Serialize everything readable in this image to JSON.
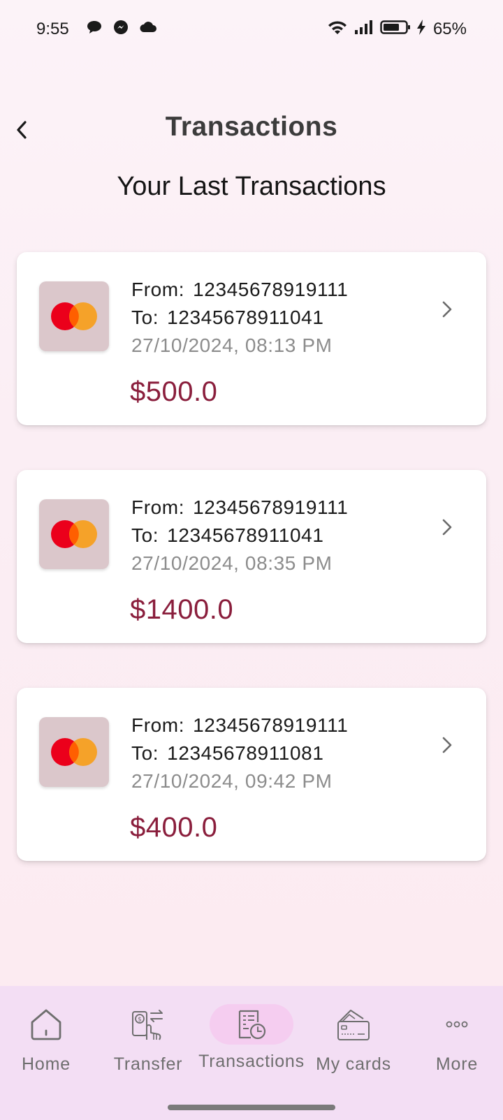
{
  "status_bar": {
    "time": "9:55",
    "battery": "65%",
    "notification_icons": [
      "chat-bubble-icon",
      "messenger-icon",
      "cloud-icon"
    ],
    "system_icons": [
      "wifi-icon",
      "signal-icon",
      "battery-icon",
      "charging-icon"
    ]
  },
  "header": {
    "title": "Transactions",
    "back_icon": "chevron-left-icon"
  },
  "subtitle": "Your Last Transactions",
  "transactions": [
    {
      "from_label": "From:",
      "from": "12345678919111",
      "to_label": "To:",
      "to": "12345678911041",
      "date": "27/10/2024, 08:13 PM",
      "amount": "$500.0"
    },
    {
      "from_label": "From:",
      "from": "12345678919111",
      "to_label": "To:",
      "to": "12345678911041",
      "date": "27/10/2024, 08:35 PM",
      "amount": "$1400.0"
    },
    {
      "from_label": "From:",
      "from": "12345678919111",
      "to_label": "To:",
      "to": "12345678911081",
      "date": "27/10/2024, 09:42 PM",
      "amount": "$400.0"
    }
  ],
  "colors": {
    "amount": "#8a1e3c",
    "card_logo_bg": "#dbc7cb",
    "mastercard_red": "#eb001b",
    "mastercard_orange": "#f79e1b",
    "nav_bg": "#f3def4",
    "nav_active_pill": "#f5cdf0"
  },
  "bottom_nav": {
    "active": "Transactions",
    "items": [
      {
        "label": "Home",
        "icon": "home-icon"
      },
      {
        "label": "Transfer",
        "icon": "transfer-icon"
      },
      {
        "label": "Transactions",
        "icon": "transactions-icon"
      },
      {
        "label": "My cards",
        "icon": "credit-card-icon"
      },
      {
        "label": "More",
        "icon": "more-icon"
      }
    ]
  }
}
